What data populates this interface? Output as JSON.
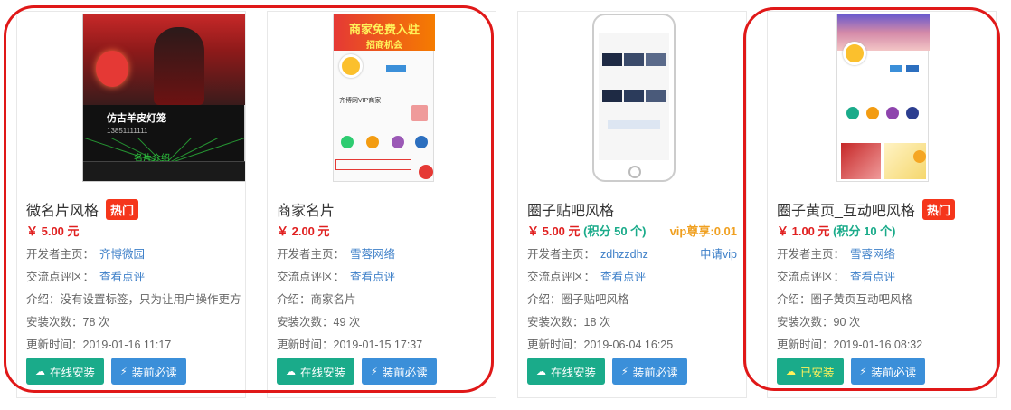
{
  "colors": {
    "accent_red": "#e01818",
    "install_green": "#1aab8a",
    "read_blue": "#3b8fd9",
    "link_blue": "#3d7fc8",
    "hot_red": "#f5361b",
    "price_red": "#e02020"
  },
  "labels": {
    "developer_prefix": "开发者主页：",
    "review_prefix": "交流点评区：",
    "review_link": "查看点评",
    "install_count_prefix": "安装次数：",
    "update_prefix": "更新时间：",
    "install_button": "在线安装",
    "installed_button": "已安装",
    "read_button": "装前必读",
    "hot_badge": "热门"
  },
  "cards": [
    {
      "title": "微名片风格",
      "hot": true,
      "price": "￥ 5.00 元",
      "points": "",
      "vip": "",
      "developer": "齐博微园",
      "vip_request": "",
      "intro": "介绍：没有设置标签，只为让用户操作更方",
      "installs": "78 次",
      "updated": "2019-01-16 11:17",
      "installed": false,
      "thumb_text": {
        "name": "仿古羊皮灯笼",
        "tab": "名片介绍",
        "phone": "13851111111"
      }
    },
    {
      "title": "商家名片",
      "hot": false,
      "price": "￥ 2.00 元",
      "points": "",
      "vip": "",
      "developer": "雪蓉网络",
      "vip_request": "",
      "intro": "介绍：商家名片",
      "installs": "49 次",
      "updated": "2019-01-15 17:37",
      "installed": false,
      "thumb_text": {
        "banner": "商家免费入驻",
        "sub": "招商机会",
        "shop": "齐博网VIP商家"
      }
    },
    {
      "title": "圈子贴吧风格",
      "hot": false,
      "price": "￥ 5.00 元",
      "points": "(积分 50 个)",
      "vip": "vip尊享:0.01",
      "developer": "zdhzzdhz",
      "vip_request": "申请vip",
      "intro": "介绍：圈子贴吧风格",
      "installs": "18 次",
      "updated": "2019-06-04 16:25",
      "installed": false,
      "thumb_text": {}
    },
    {
      "title": "圈子黄页_互动吧风格",
      "hot": true,
      "price": "￥ 1.00 元",
      "points": "(积分 10 个)",
      "vip": "",
      "developer": "雪蓉网络",
      "vip_request": "",
      "intro": "介绍：圈子黄页互动吧风格",
      "installs": "90 次",
      "updated": "2019-01-16 08:32",
      "installed": true,
      "thumb_text": {}
    }
  ]
}
